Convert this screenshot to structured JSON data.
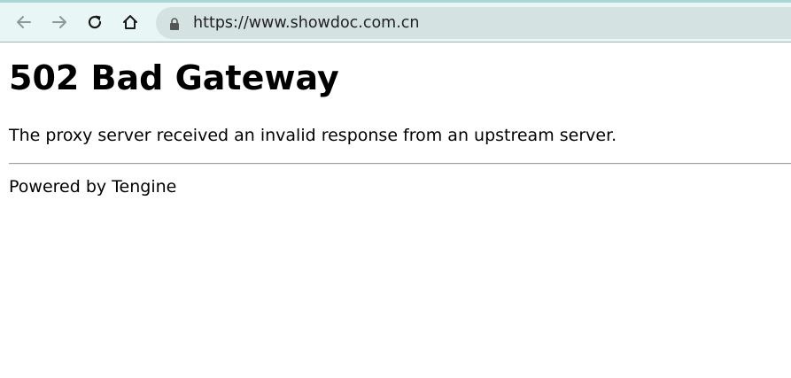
{
  "browser": {
    "url": "https://www.showdoc.com.cn",
    "back_icon": "back-arrow-icon",
    "forward_icon": "forward-arrow-icon",
    "reload_icon": "reload-icon",
    "home_icon": "home-icon",
    "lock_icon": "lock-icon",
    "colors": {
      "toolbar_bg": "#e8f6f6",
      "address_bar_bg": "#d5e2e2"
    }
  },
  "page": {
    "title": "502 Bad Gateway",
    "message": "The proxy server received an invalid response from an upstream server.",
    "footer": "Powered by Tengine"
  }
}
